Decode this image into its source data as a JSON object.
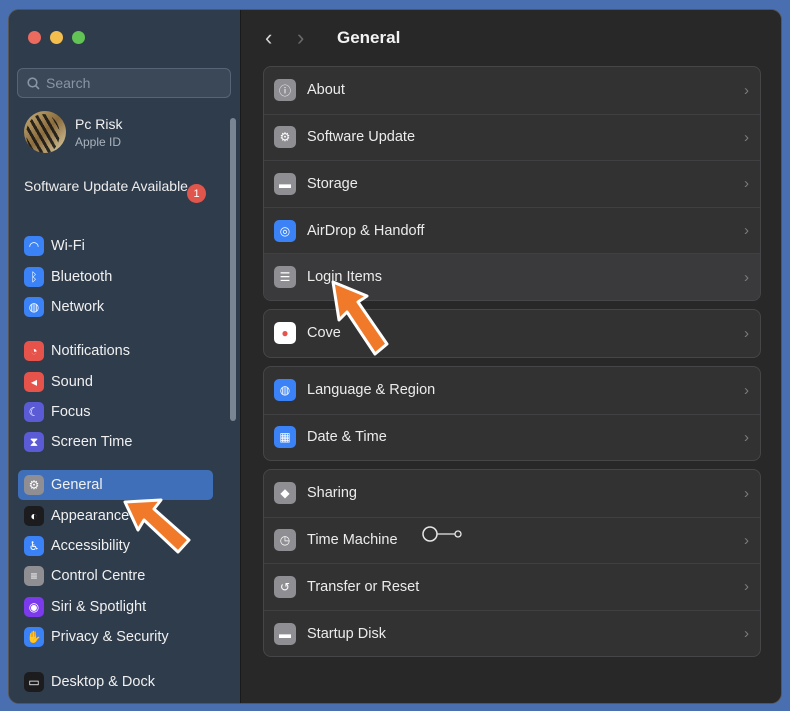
{
  "window": {
    "title": "General",
    "nav_back": "‹",
    "nav_forward": "›"
  },
  "sidebar": {
    "search_placeholder": "Search",
    "profile": {
      "name": "Pc Risk",
      "subtitle": "Apple ID"
    },
    "update_notice": {
      "label": "Software Update Available",
      "badge": "1"
    },
    "groups": [
      [
        {
          "label": "Wi-Fi",
          "icon": "wifi-icon",
          "color": "#3b82f6",
          "glyph": "◠"
        },
        {
          "label": "Bluetooth",
          "icon": "bluetooth-icon",
          "color": "#3b82f6",
          "glyph": "ᛒ"
        },
        {
          "label": "Network",
          "icon": "globe-icon",
          "color": "#3b82f6",
          "glyph": "◍"
        }
      ],
      [
        {
          "label": "Notifications",
          "icon": "bell-icon",
          "color": "#e5534b",
          "glyph": "◔"
        },
        {
          "label": "Sound",
          "icon": "speaker-icon",
          "color": "#e5534b",
          "glyph": "◂"
        },
        {
          "label": "Focus",
          "icon": "moon-icon",
          "color": "#5b5bd6",
          "glyph": "☾"
        },
        {
          "label": "Screen Time",
          "icon": "hourglass-icon",
          "color": "#5b5bd6",
          "glyph": "⧗"
        }
      ],
      [
        {
          "label": "General",
          "icon": "gear-icon",
          "color": "#8e8e93",
          "glyph": "⚙",
          "active": true
        },
        {
          "label": "Appearance",
          "icon": "appearance-icon",
          "color": "#1c1c1e",
          "glyph": "◐"
        },
        {
          "label": "Accessibility",
          "icon": "accessibility-icon",
          "color": "#3b82f6",
          "glyph": "♿"
        },
        {
          "label": "Control Centre",
          "icon": "control-centre-icon",
          "color": "#8e8e93",
          "glyph": "≡"
        },
        {
          "label": "Siri & Spotlight",
          "icon": "siri-icon",
          "color": "#7c3aed",
          "glyph": "◉"
        },
        {
          "label": "Privacy & Security",
          "icon": "hand-icon",
          "color": "#3b82f6",
          "glyph": "✋"
        }
      ],
      [
        {
          "label": "Desktop & Dock",
          "icon": "dock-icon",
          "color": "#1c1c1e",
          "glyph": "▭"
        }
      ]
    ]
  },
  "main": {
    "cards": [
      [
        {
          "label": "About",
          "icon": "about-icon",
          "color": "#8e8e93",
          "glyph": "ⓘ"
        },
        {
          "label": "Software Update",
          "icon": "software-update-icon",
          "color": "#8e8e93",
          "glyph": "⚙"
        },
        {
          "label": "Storage",
          "icon": "storage-icon",
          "color": "#8e8e93",
          "glyph": "▬"
        },
        {
          "label": "AirDrop & Handoff",
          "icon": "airdrop-icon",
          "color": "#3b82f6",
          "glyph": "◎"
        },
        {
          "label": "Login Items",
          "icon": "login-items-icon",
          "color": "#8e8e93",
          "glyph": "☰",
          "highlight": true
        }
      ],
      [
        {
          "label": "Cove",
          "icon": "apple-icon",
          "color": "#ffffff",
          "glyph": "●"
        }
      ],
      [
        {
          "label": "Language & Region",
          "icon": "globe-icon",
          "color": "#3b82f6",
          "glyph": "◍"
        },
        {
          "label": "Date & Time",
          "icon": "calendar-icon",
          "color": "#3b82f6",
          "glyph": "▦"
        }
      ],
      [
        {
          "label": "Sharing",
          "icon": "sharing-icon",
          "color": "#8e8e93",
          "glyph": "◆"
        },
        {
          "label": "Time Machine",
          "icon": "time-machine-icon",
          "color": "#8e8e93",
          "glyph": "◷"
        },
        {
          "label": "Transfer or Reset",
          "icon": "reset-icon",
          "color": "#8e8e93",
          "glyph": "↺"
        },
        {
          "label": "Startup Disk",
          "icon": "disk-icon",
          "color": "#8e8e93",
          "glyph": "▬"
        }
      ]
    ],
    "chevron": "›"
  },
  "annotations": {
    "arrow_color": "#f07a2a"
  }
}
